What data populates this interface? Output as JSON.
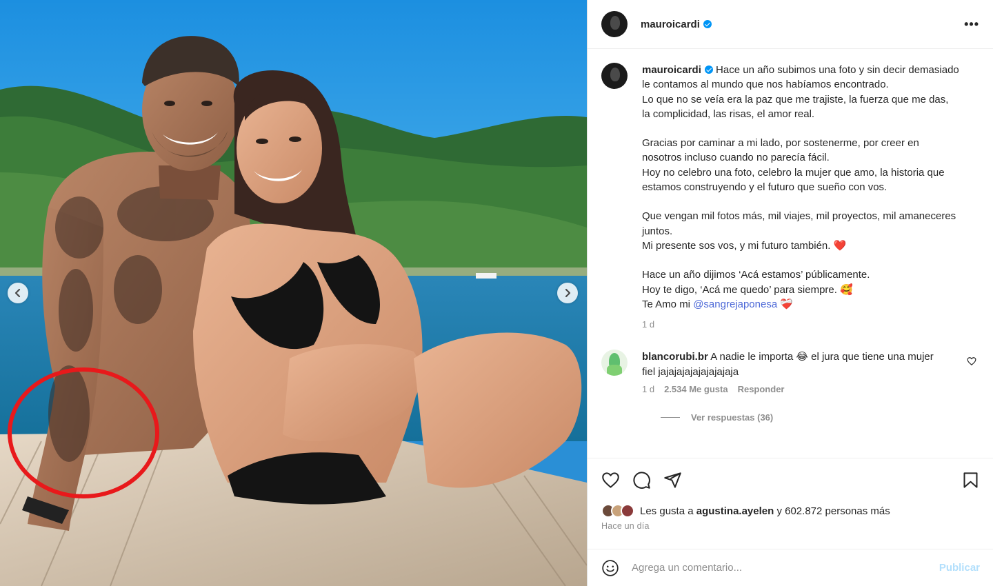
{
  "post": {
    "username": "mauroicardi",
    "more_icon": "more-horizontal-icon",
    "caption_lines": [
      "Hace un año subimos una foto y sin decir demasiado le contamos al mundo que nos habíamos encontrado.",
      "Lo que no se veía era la paz que me trajiste, la fuerza que me das, la complicidad, las risas, el amor real.",
      "Gracias por caminar a mi lado, por sostenerme, por creer en nosotros incluso cuando no parecía fácil.",
      "Hoy no celebro una foto, celebro la mujer que amo, la historia que estamos construyendo y el futuro que sueño con vos.",
      "Que vengan mil fotos más, mil viajes, mil proyectos, mil amaneceres juntos.",
      "Mi presente sos vos, y mi futuro también. ❤️",
      "Hace un año dijimos ‘Acá estamos’ públicamente.",
      "Hoy te digo, ‘Acá me quedo’ para siempre. 🥰",
      "Te Amo mi"
    ],
    "mention": "@sangrejaponesa",
    "mention_suffix": "❤️‍🩹",
    "caption_time": "1 d"
  },
  "comment": {
    "username": "blancorubi.br",
    "text": "A nadie le importa 😂 el jura que tiene una mujer fiel jajajajajajajajajaja",
    "time": "1 d",
    "likes": "2.534 Me gusta",
    "reply_label": "Responder",
    "view_replies": "Ver respuestas (36)"
  },
  "likes": {
    "prefix": "Les gusta a",
    "user": "agustina.ayelen",
    "suffix": "y 602.872 personas más",
    "avatar_colors": [
      "#6b4a3a",
      "#c8a27a",
      "#8a3a3a"
    ]
  },
  "posted": "Hace un día",
  "composer": {
    "placeholder": "Agrega un comentario...",
    "publish_label": "Publicar"
  },
  "carousel": {
    "total": 20,
    "active_index": 17
  },
  "colors": {
    "link": "#4c68d7",
    "verified": "#0095f6",
    "publish": "#b2dffc",
    "annotation_circle": "#e8191b"
  }
}
